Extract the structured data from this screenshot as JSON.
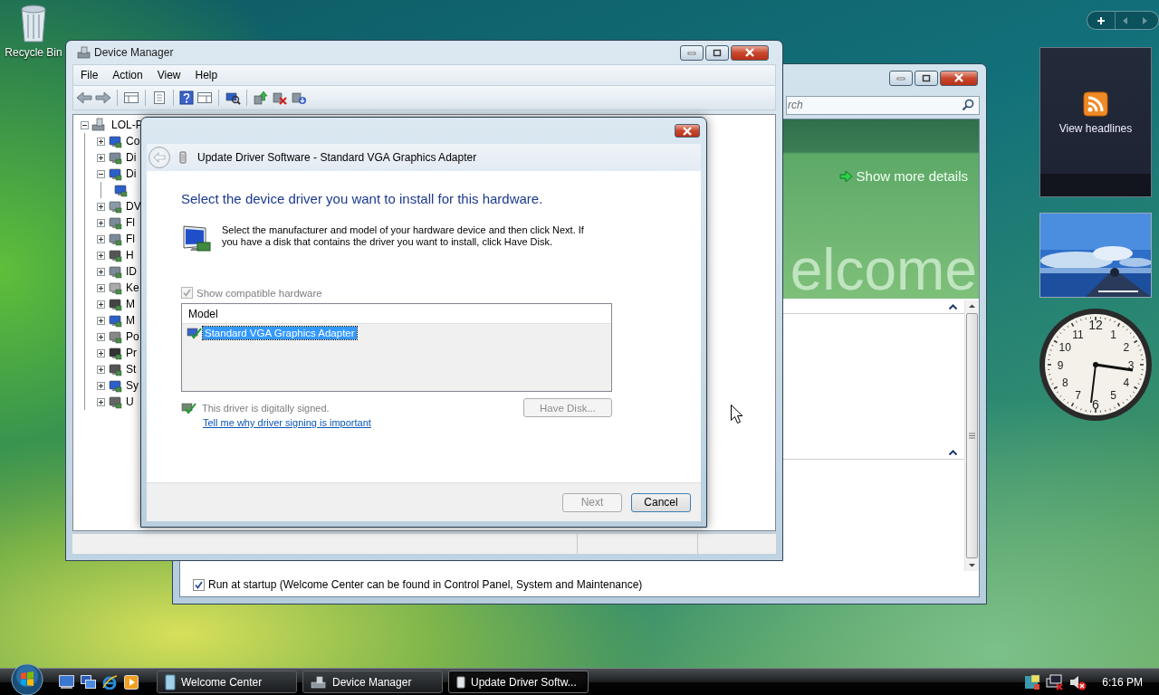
{
  "desktop": {
    "icons": [
      {
        "label": "Recycle Bin"
      }
    ]
  },
  "welcome_center": {
    "search": {
      "placeholder": "rch"
    },
    "banner": {
      "link": "Show more details",
      "watermark": "elcome"
    },
    "run_at_startup": {
      "label": "Run at startup (Welcome Center can be found in Control Panel, System and Maintenance)",
      "checked": true
    }
  },
  "device_manager": {
    "title": "Device Manager",
    "menu": [
      "File",
      "Action",
      "View",
      "Help"
    ],
    "tree": {
      "label": "LOL-P",
      "expanded": true,
      "children": [
        {
          "label": "Co",
          "expanded": false
        },
        {
          "label": "Di",
          "expanded": false
        },
        {
          "label": "Di",
          "expanded": true,
          "children": [
            {
              "kind": "device"
            }
          ]
        },
        {
          "label": "DV",
          "expanded": false
        },
        {
          "label": "Fl",
          "expanded": false
        },
        {
          "label": "Fl",
          "expanded": false
        },
        {
          "label": "H",
          "expanded": false
        },
        {
          "label": "ID",
          "expanded": false
        },
        {
          "label": "Ke",
          "expanded": false
        },
        {
          "label": "M",
          "expanded": false
        },
        {
          "label": "M",
          "expanded": false
        },
        {
          "label": "Po",
          "expanded": false
        },
        {
          "label": "Pr",
          "expanded": false
        },
        {
          "label": "St",
          "expanded": false
        },
        {
          "label": "Sy",
          "expanded": false
        },
        {
          "label": "U",
          "expanded": false
        }
      ]
    }
  },
  "dialog": {
    "title": "Update Driver Software - Standard VGA Graphics Adapter",
    "heading": "Select the device driver you want to install for this hardware.",
    "instructions": "Select the manufacturer and model of your hardware device and then click Next. If you have a disk that contains the driver you want to install, click Have Disk.",
    "show_compatible": {
      "label": "Show compatible hardware",
      "checked": true,
      "disabled": true
    },
    "list": {
      "column": "Model",
      "items": [
        {
          "label": "Standard VGA Graphics Adapter",
          "selected": true
        }
      ]
    },
    "signed_note": "This driver is digitally signed.",
    "link": "Tell me why driver signing is important",
    "have_disk": {
      "label": "Have Disk...",
      "disabled": true
    },
    "buttons": [
      {
        "label": "Next",
        "disabled": true
      },
      {
        "label": "Cancel",
        "disabled": false
      }
    ]
  },
  "sidebar": {
    "feed": {
      "label": "View headlines"
    },
    "clock": {
      "numerals": [
        "12",
        "11",
        "1",
        "10",
        "2",
        "9",
        "3",
        "8",
        "4",
        "7",
        "5",
        "6"
      ]
    }
  },
  "taskbar": {
    "tasks": [
      {
        "label": "Welcome Center",
        "selected": false
      },
      {
        "label": "Device Manager",
        "selected": false
      },
      {
        "label": "Update Driver Softw...",
        "selected": true
      }
    ],
    "clock": "6:16 PM"
  }
}
